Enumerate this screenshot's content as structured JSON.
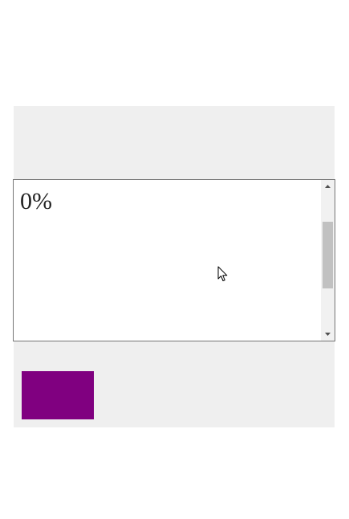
{
  "scroll_box": {
    "text": "0%",
    "scroll_position_fraction": 0.42
  },
  "icons": {
    "scroll_up": "triangle-up-icon",
    "scroll_down": "triangle-down-icon",
    "cursor": "mouse-pointer-icon"
  },
  "colors": {
    "panel_background": "#efefef",
    "box_fill": "#800080",
    "scroll_thumb": "#c1c1c1",
    "scroll_track": "#f1f1f1",
    "box_border": "#767676"
  }
}
